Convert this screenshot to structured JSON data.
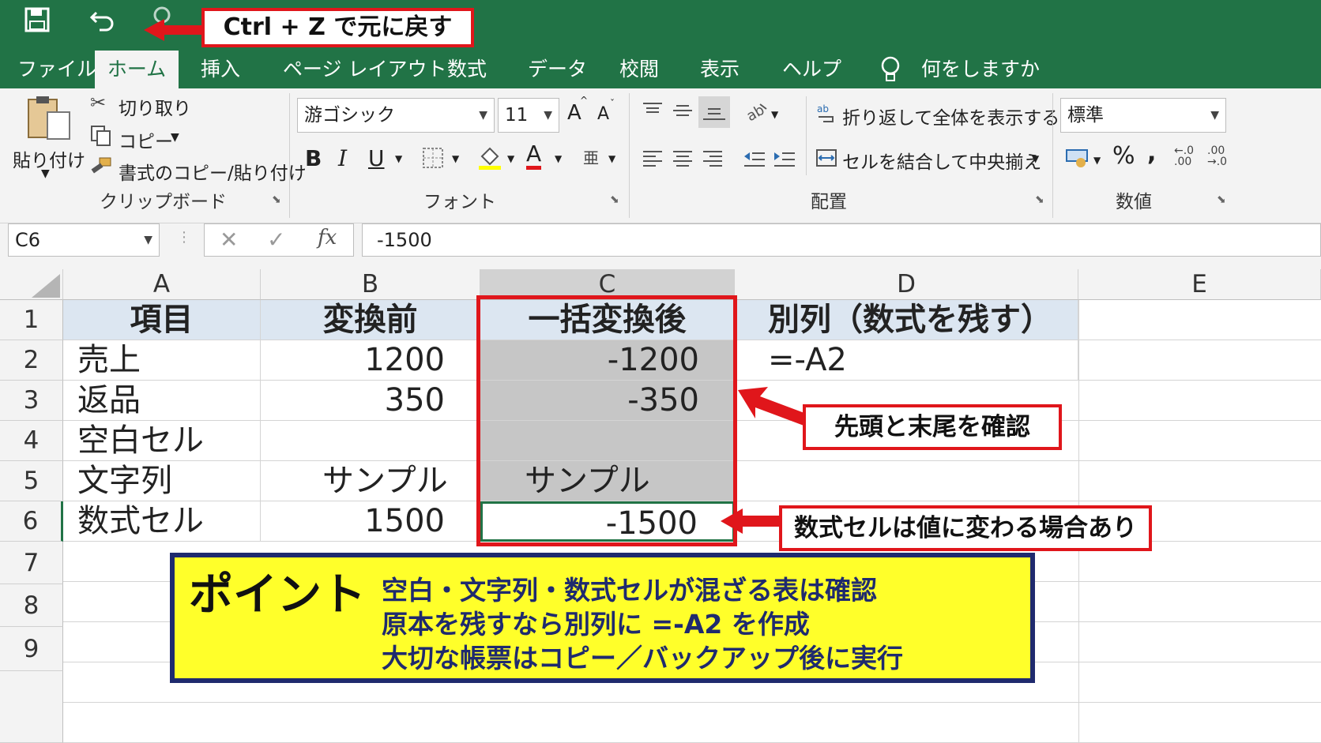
{
  "quick_access": {
    "save_icon": "save-icon",
    "undo_icon": "undo-icon",
    "redo_icon": "redo-icon"
  },
  "callouts": {
    "ctrlz": "Ctrl + Z で元に戻す",
    "check_edges": "先頭と末尾を確認",
    "formula_note": "数式セルは値に変わる場合あり"
  },
  "tabs": [
    "ファイル",
    "ホーム",
    "挿入",
    "ページ レイアウト",
    "数式",
    "データ",
    "校閲",
    "表示",
    "ヘルプ"
  ],
  "tell_me": "何をしますか",
  "ribbon": {
    "clipboard": {
      "paste": "貼り付け",
      "cut": "切り取り",
      "copy": "コピー",
      "format_painter": "書式のコピー/貼り付け",
      "label": "クリップボード"
    },
    "font": {
      "font_name": "游ゴシック",
      "font_size": "11",
      "bold": "B",
      "italic": "I",
      "underline": "U",
      "grow": "A",
      "shrink": "A",
      "font_color": "A",
      "label": "フォント"
    },
    "alignment": {
      "wrap": "折り返して全体を表示する",
      "merge": "セルを結合して中央揃え",
      "label": "配置"
    },
    "number": {
      "format": "標準",
      "percent": "%",
      "comma": ",",
      "label": "数値"
    }
  },
  "formula_bar": {
    "name_box": "C6",
    "cancel": "✕",
    "enter": "✓",
    "fx": "fx",
    "value": "-1500"
  },
  "columns": [
    "A",
    "B",
    "C",
    "D",
    "E"
  ],
  "rows": [
    "1",
    "2",
    "3",
    "4",
    "5",
    "6",
    "7",
    "8",
    "9"
  ],
  "table": {
    "headers": [
      "項目",
      "変換前",
      "一括変換後",
      "別列（数式を残す）"
    ],
    "rows": [
      [
        "売上",
        "1200",
        "-1200",
        "=-A2"
      ],
      [
        "返品",
        "350",
        "-350",
        ""
      ],
      [
        "空白セル",
        "",
        "",
        ""
      ],
      [
        "文字列",
        "サンプル",
        "サンプル",
        ""
      ],
      [
        "数式セル",
        "1500",
        "-1500",
        ""
      ]
    ]
  },
  "point": {
    "title": "ポイント",
    "lines": [
      "空白・文字列・数式セルが混ざる表は確認",
      "原本を残すなら別列に =-A2 を作成",
      "大切な帳票はコピー／バックアップ後に実行"
    ]
  },
  "colors": {
    "excel_green": "#217346",
    "callout_red": "#e0161b",
    "point_yellow": "#ffff2a",
    "point_border": "#1f2a6e",
    "header_blue": "#dce6f1",
    "selection_gray": "#c6c6c6"
  }
}
